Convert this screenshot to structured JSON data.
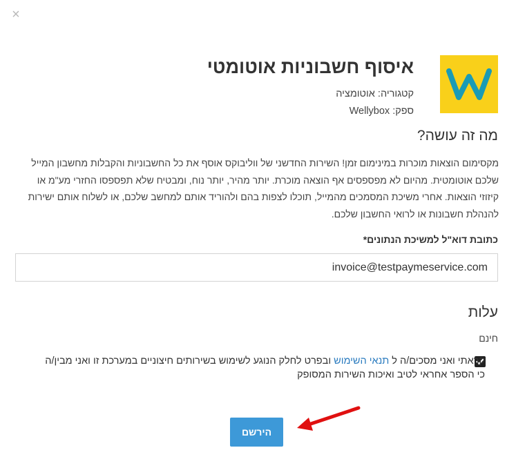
{
  "dialog": {
    "close_glyph": "×",
    "title": "איסוף חשבוניות אוטומטי",
    "category": "קטגוריה: אוטומציה",
    "provider": "ספק: Wellybox",
    "logo_letter": "W",
    "brand_color": "#f9d01a",
    "logo_letter_color": "#1a9bb5"
  },
  "about": {
    "heading": "מה זה עושה?",
    "description": "מקסימום הוצאות מוכרות במינימום זמן! השירות החדשני של ווליבוקס אוסף את כל החשבוניות והקבלות מחשבון המייל שלכם אוטומטית. מהיום לא מפספסים אף הוצאה מוכרת. יותר מהיר, יותר נוח, ומבטיח שלא תפספסו החזרי מע\"מ או קיזוזי הוצאות. אחרי משיכת המסמכים מהמייל, תוכלו לצפות בהם ולהוריד אותם למחשב שלכם, או לשלוח אותם ישירות להנהלת חשבונות או לרואי החשבון שלכם."
  },
  "form": {
    "email_label": "כתובת דוא\"ל למשיכת הנתונים*",
    "email_value": "invoice@testpaymeservice.com"
  },
  "pricing": {
    "heading": "עלות",
    "price": "חינם"
  },
  "terms": {
    "checked": true,
    "text_before": "קראתי ואני מסכים/ה ל ",
    "link_text": "תנאי השימוש",
    "text_after": " ובפרט לחלק הנוגע לשימוש בשירותים חיצוניים במערכת זו ואני מבין/ה כי הספר אחראי לטיב ואיכות השירות המסופק"
  },
  "actions": {
    "register_label": "הירשם",
    "button_color": "#3d99d8",
    "arrow_color": "#e01010"
  }
}
